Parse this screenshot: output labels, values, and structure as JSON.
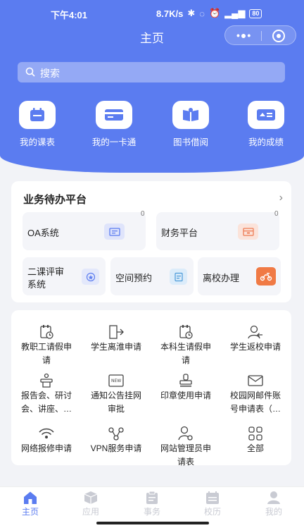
{
  "status": {
    "time": "下午4:01",
    "speed": "8.7K/s",
    "battery": "80"
  },
  "header": {
    "title": "主页"
  },
  "search": {
    "placeholder": "搜索"
  },
  "quick": [
    {
      "label": "我的课表",
      "icon": "calendar-icon"
    },
    {
      "label": "我的一卡通",
      "icon": "card-icon"
    },
    {
      "label": "图书借阅",
      "icon": "book-icon"
    },
    {
      "label": "我的成绩",
      "icon": "grade-icon"
    }
  ],
  "platform": {
    "title": "业务待办平台",
    "tiles": [
      {
        "label": "OA系统",
        "badge": "0"
      },
      {
        "label": "财务平台",
        "badge": "0"
      },
      {
        "label1": "二课评审",
        "label2": "系统"
      },
      {
        "label": "空间预约"
      },
      {
        "label": "离校办理"
      }
    ]
  },
  "apps": [
    {
      "l1": "教职工请假申",
      "l2": "请"
    },
    {
      "l1": "学生离淮申请",
      "l2": ""
    },
    {
      "l1": "本科生请假申",
      "l2": "请"
    },
    {
      "l1": "学生返校申请",
      "l2": ""
    },
    {
      "l1": "报告会、研讨",
      "l2": "会、讲座、…"
    },
    {
      "l1": "通知公告挂网",
      "l2": "审批"
    },
    {
      "l1": "印章使用申请",
      "l2": ""
    },
    {
      "l1": "校园网邮件账",
      "l2": "号申请表（…"
    },
    {
      "l1": "网络报修申请",
      "l2": ""
    },
    {
      "l1": "VPN服务申请",
      "l2": ""
    },
    {
      "l1": "网站管理员申",
      "l2": "请表"
    },
    {
      "l1": "全部",
      "l2": ""
    }
  ],
  "tabs": [
    "主页",
    "应用",
    "事务",
    "校历",
    "我的"
  ],
  "colors": {
    "primary": "#5b7cf0",
    "background": "#f2f3f7",
    "tab_inactive": "#c9cbd3"
  }
}
